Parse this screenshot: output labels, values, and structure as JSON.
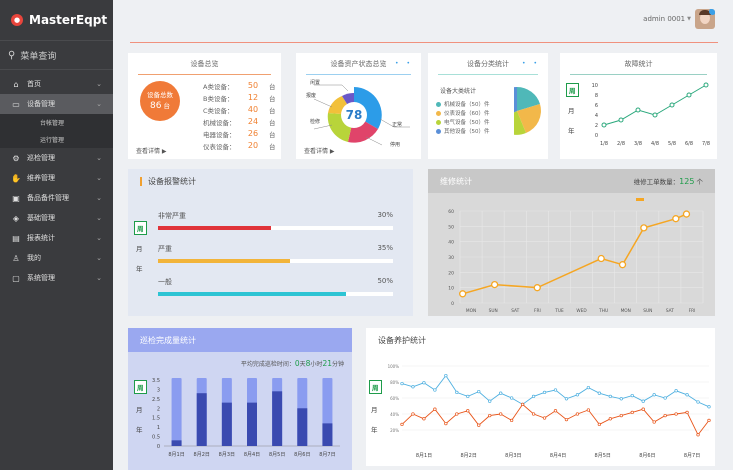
{
  "app": {
    "name": "MasterEqpt"
  },
  "search": {
    "label": "菜单查询"
  },
  "menu": [
    {
      "label": "首页",
      "icon": "home-icon",
      "chev": "⌄"
    },
    {
      "label": "设备管理",
      "icon": "monitor-icon",
      "chev": "⌄",
      "active": true
    },
    {
      "label": "台帐管理",
      "sub": true
    },
    {
      "label": "运行管理",
      "sub": true
    },
    {
      "label": "巡检管理",
      "icon": "gear-icon",
      "chev": "⌄"
    },
    {
      "label": "维养管理",
      "icon": "hand-icon",
      "chev": "⌄"
    },
    {
      "label": "备品备件管理",
      "icon": "box-icon",
      "chev": "⌄"
    },
    {
      "label": "基础管理",
      "icon": "layers-icon",
      "chev": "⌄"
    },
    {
      "label": "报表统计",
      "icon": "report-icon",
      "chev": "⌄"
    },
    {
      "label": "我的",
      "icon": "user-icon",
      "chev": "⌄"
    },
    {
      "label": "系统管理",
      "icon": "display-icon",
      "chev": "⌄"
    }
  ],
  "user": {
    "name": "admin 0001",
    "caret": "▼"
  },
  "overview": {
    "title": "设备总览",
    "total_label": "设备总数",
    "total_value": "86",
    "total_unit": "台",
    "rows": [
      {
        "label": "A类设备：",
        "value": "50",
        "unit": "台"
      },
      {
        "label": "B类设备：",
        "value": "12",
        "unit": "台"
      },
      {
        "label": "C类设备：",
        "value": "40",
        "unit": "台"
      },
      {
        "label": "机械设备：",
        "value": "24",
        "unit": "台"
      },
      {
        "label": "电器设备：",
        "value": "26",
        "unit": "台"
      },
      {
        "label": "仪表设备：",
        "value": "20",
        "unit": "台"
      }
    ],
    "more": "查看详情 ▶"
  },
  "asset": {
    "title": "设备资产状态总览",
    "center": "78",
    "labels": {
      "idle": "闲置",
      "scrap": "报废",
      "repair": "检修",
      "normal": "正常",
      "disabled": "停用"
    },
    "more": "查看详情 ▶",
    "dots": "• •"
  },
  "category": {
    "title": "设备分类统计",
    "subtitle": "设备大类统计",
    "dots": "• •",
    "legend": [
      {
        "label": "机械设备（50）件",
        "color": "#4fb8b8"
      },
      {
        "label": "仪表设备（60）件",
        "color": "#f2b84a"
      },
      {
        "label": "电气设备（50）件",
        "color": "#b8d43a"
      },
      {
        "label": "其他设备（50）件",
        "color": "#5a8fd8"
      }
    ],
    "slices": [
      50,
      60,
      50,
      50
    ]
  },
  "fault": {
    "title": "故障统计",
    "tabs": [
      "周",
      "月",
      "年"
    ],
    "chart_data": {
      "type": "line",
      "categories": [
        "1/8",
        "2/8",
        "3/8",
        "4/8",
        "5/8",
        "6/8",
        "7/8"
      ],
      "values": [
        2,
        3,
        5,
        4,
        6,
        8,
        10
      ],
      "ylim": [
        0,
        10
      ],
      "yticks": [
        0,
        2,
        4,
        6,
        8,
        10
      ]
    }
  },
  "alarm": {
    "title": "设备报警统计",
    "tabs": [
      "周",
      "月",
      "年"
    ],
    "items": [
      {
        "label": "非常严重",
        "value": "30%",
        "pct": 30,
        "color": "#e0333a"
      },
      {
        "label": "严重",
        "value": "35%",
        "pct": 35,
        "color": "#f2b43a"
      },
      {
        "label": "一般",
        "value": "50%",
        "pct": 50,
        "color": "#2dc4d4"
      }
    ]
  },
  "repair": {
    "title": "维修统计",
    "count_label": "维修工单数量：",
    "count": "125",
    "count_unit": "个",
    "chart_data": {
      "type": "line",
      "categories": [
        "MON",
        "SUN",
        "SAT",
        "FRI",
        "TUE",
        "WED",
        "THU",
        "MON",
        "SUN",
        "SAT",
        "FRI"
      ],
      "values": [
        6,
        12,
        null,
        10,
        null,
        null,
        29,
        25,
        49,
        null,
        55,
        null,
        58
      ],
      "x": [
        0.5,
        2,
        null,
        4,
        null,
        null,
        7,
        8,
        9,
        null,
        10.5,
        null,
        11
      ],
      "ylim": [
        0,
        60
      ],
      "yticks": [
        0,
        10,
        20,
        30,
        40,
        50,
        60
      ]
    }
  },
  "patrol": {
    "title": "巡检完成量统计",
    "avg_label": "平均完成巡检时间：",
    "avg_0": "0",
    "avg_d": "天",
    "avg_8": "8",
    "avg_h": "小时",
    "avg_21": "21",
    "avg_m": "分钟",
    "tabs": [
      "周",
      "月",
      "年"
    ],
    "chart_data": {
      "type": "bar",
      "categories": [
        "8月1日",
        "8月2日",
        "8月3日",
        "8月4日",
        "8月5日",
        "8月6日",
        "8月7日"
      ],
      "totals": [
        3.5,
        3.5,
        3.5,
        3.5,
        3.5,
        3.5,
        3.5
      ],
      "values": [
        0.3,
        2.8,
        2.3,
        2.3,
        2.9,
        2.0,
        1.2
      ],
      "ylim": [
        0,
        3.5
      ],
      "yticks": [
        0,
        0.5,
        1,
        1.5,
        2,
        2.5,
        3,
        3.5
      ]
    }
  },
  "maint": {
    "title": "设备养护统计",
    "tabs": [
      "周",
      "月",
      "年"
    ],
    "chart_data": {
      "type": "line",
      "categories": [
        "8月1日",
        "8月2日",
        "8月3日",
        "8月4日",
        "8月5日",
        "8月6日",
        "8月7日"
      ],
      "ylim": [
        0,
        1
      ],
      "yticks": [
        "20%",
        "40%",
        "60%",
        "80%",
        "100%"
      ],
      "series": [
        {
          "color": "#4fb0e0",
          "values": [
            0.78,
            0.74,
            0.79,
            0.7,
            0.88,
            0.67,
            0.62,
            0.68,
            0.56,
            0.66,
            0.6,
            0.52,
            0.62,
            0.67,
            0.7,
            0.59,
            0.64,
            0.73,
            0.66,
            0.62,
            0.59,
            0.63,
            0.56,
            0.64,
            0.6,
            0.69,
            0.64,
            0.55,
            0.49
          ]
        },
        {
          "color": "#e8551a",
          "values": [
            0.27,
            0.4,
            0.34,
            0.46,
            0.28,
            0.4,
            0.44,
            0.26,
            0.38,
            0.4,
            0.32,
            0.52,
            0.4,
            0.35,
            0.44,
            0.33,
            0.4,
            0.45,
            0.27,
            0.34,
            0.38,
            0.42,
            0.46,
            0.3,
            0.38,
            0.4,
            0.42,
            0.14,
            0.32
          ]
        }
      ]
    }
  }
}
